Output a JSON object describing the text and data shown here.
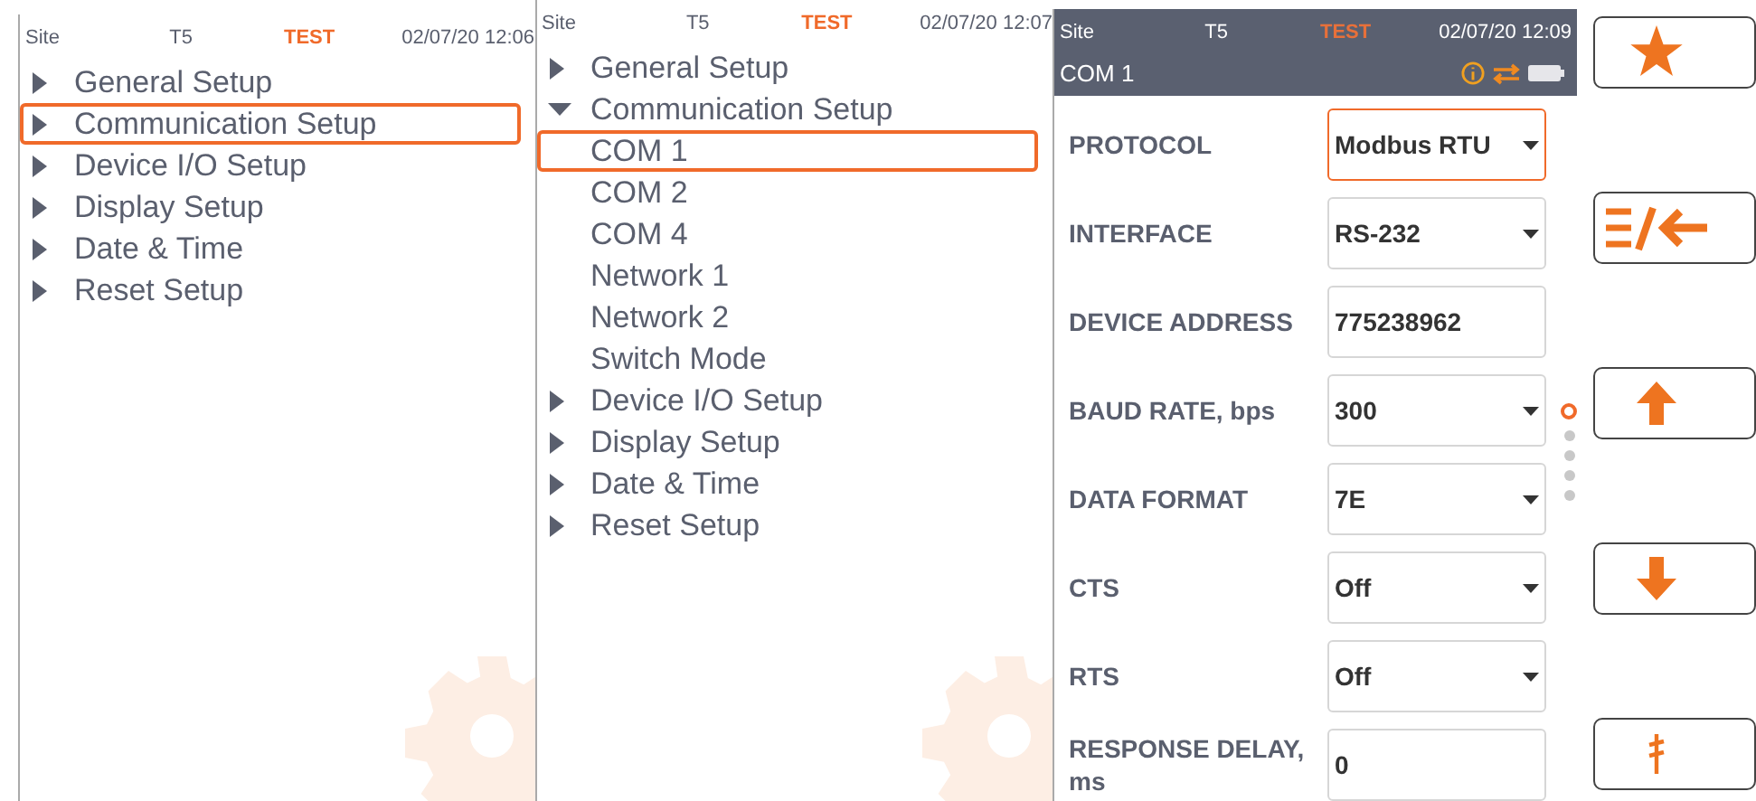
{
  "menu_panels": [
    {
      "status_bar": {
        "site": "Site",
        "unit": "T5",
        "mode": "TEST",
        "time": "02/07/20 12:06"
      },
      "items": [
        {
          "label": "General Setup",
          "expanded": false,
          "selected": false
        },
        {
          "label": "Communication Setup",
          "expanded": false,
          "selected": true
        },
        {
          "label": "Device I/O Setup",
          "expanded": false,
          "selected": false
        },
        {
          "label": "Display Setup",
          "expanded": false,
          "selected": false
        },
        {
          "label": "Date & Time",
          "expanded": false,
          "selected": false
        },
        {
          "label": "Reset Setup",
          "expanded": false,
          "selected": false
        }
      ]
    },
    {
      "status_bar": {
        "site": "Site",
        "unit": "T5",
        "mode": "TEST",
        "time": "02/07/20 12:07"
      },
      "items": [
        {
          "label": "General Setup",
          "expanded": false,
          "selected": false
        },
        {
          "label": "Communication Setup",
          "expanded": true,
          "selected": false,
          "children": [
            {
              "label": "COM 1",
              "selected": true
            },
            {
              "label": "COM 2",
              "selected": false
            },
            {
              "label": "COM 4",
              "selected": false
            },
            {
              "label": "Network 1",
              "selected": false
            },
            {
              "label": "Network 2",
              "selected": false
            },
            {
              "label": "Switch Mode",
              "selected": false
            }
          ]
        },
        {
          "label": "Device I/O Setup",
          "expanded": false,
          "selected": false
        },
        {
          "label": "Display Setup",
          "expanded": false,
          "selected": false
        },
        {
          "label": "Date & Time",
          "expanded": false,
          "selected": false
        },
        {
          "label": "Reset Setup",
          "expanded": false,
          "selected": false
        }
      ]
    }
  ],
  "form_panel": {
    "status_bar": {
      "site": "Site",
      "unit": "T5",
      "mode": "TEST",
      "time": "02/07/20 12:09"
    },
    "title": "COM 1",
    "fields": [
      {
        "label": "PROTOCOL",
        "value": "Modbus RTU",
        "kind": "dropdown",
        "selected": true
      },
      {
        "label": "INTERFACE",
        "value": "RS-232",
        "kind": "dropdown",
        "selected": false
      },
      {
        "label": "DEVICE ADDRESS",
        "value": "775238962",
        "kind": "text",
        "selected": false
      },
      {
        "label": "BAUD RATE, bps",
        "value": "300",
        "kind": "dropdown",
        "selected": false
      },
      {
        "label": "DATA FORMAT",
        "value": "7E",
        "kind": "dropdown",
        "selected": false
      },
      {
        "label": "CTS",
        "value": "Off",
        "kind": "dropdown",
        "selected": false
      },
      {
        "label": "RTS",
        "value": "Off",
        "kind": "dropdown",
        "selected": false
      },
      {
        "label": "RESPONSE DELAY, ms",
        "value": "0",
        "kind": "text",
        "selected": false
      }
    ],
    "pages": [
      {
        "selected": true
      },
      {
        "selected": false
      },
      {
        "selected": false
      },
      {
        "selected": false
      },
      {
        "selected": false
      }
    ]
  },
  "side_buttons": [
    {
      "kind": "star"
    },
    {
      "kind": "list-back"
    },
    {
      "kind": "up"
    },
    {
      "kind": "down"
    },
    {
      "kind": "special"
    }
  ]
}
